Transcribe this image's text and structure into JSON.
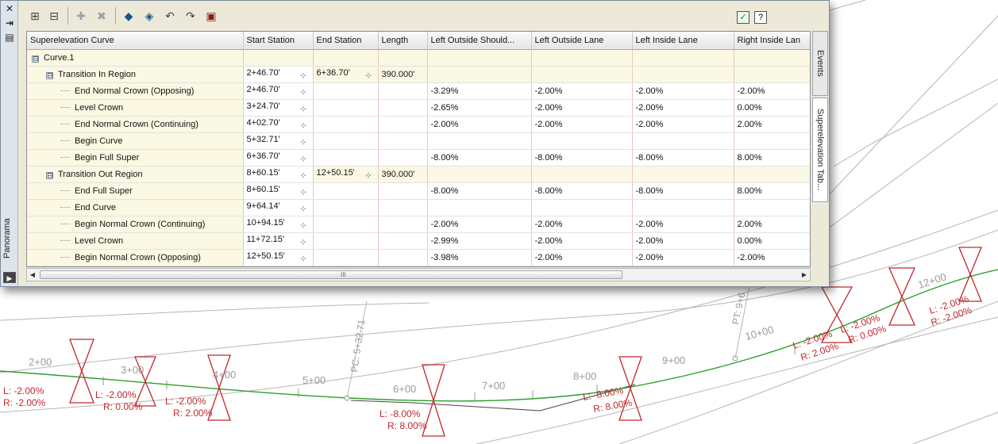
{
  "window": {
    "caption": "Panorama",
    "left_bar": {
      "close": "✕",
      "pin": "⇥",
      "props": "▤"
    },
    "toolbar_right": {
      "accept": "✓",
      "help": "?"
    }
  },
  "table": {
    "columns": [
      "Superelevation Curve",
      "Start Station",
      "End Station",
      "Length",
      "Left Outside Should...",
      "Left Outside Lane",
      "Left Inside Lane",
      "Right Inside Lan"
    ],
    "rows": [
      {
        "level": 0,
        "kind": "root",
        "expander": "⊟",
        "name": "Curve.1",
        "start": "",
        "end": "",
        "length": "",
        "los": "",
        "lol": "",
        "lil": "",
        "ril": ""
      },
      {
        "level": 1,
        "kind": "region",
        "expander": "⊟",
        "name": "Transition In Region",
        "start": "2+46.70'",
        "end": "6+36.70'",
        "length": "390.000'",
        "los": "",
        "lol": "",
        "lil": "",
        "ril": ""
      },
      {
        "level": 2,
        "kind": "item",
        "name": "End Normal Crown (Opposing)",
        "start": "2+46.70'",
        "end": "",
        "length": "",
        "los": "-3.29%",
        "lol": "-2.00%",
        "lil": "-2.00%",
        "ril": "-2.00%"
      },
      {
        "level": 2,
        "kind": "item",
        "name": "Level Crown",
        "start": "3+24.70'",
        "end": "",
        "length": "",
        "los": "-2.65%",
        "lol": "-2.00%",
        "lil": "-2.00%",
        "ril": "0.00%"
      },
      {
        "level": 2,
        "kind": "item",
        "name": "End Normal Crown (Continuing)",
        "start": "4+02.70'",
        "end": "",
        "length": "",
        "los": "-2.00%",
        "lol": "-2.00%",
        "lil": "-2.00%",
        "ril": "2.00%"
      },
      {
        "level": 2,
        "kind": "item-plain",
        "name": "Begin Curve",
        "start": "5+32.71'",
        "end": "",
        "length": "",
        "los": "",
        "lol": "",
        "lil": "",
        "ril": ""
      },
      {
        "level": 2,
        "kind": "item",
        "name": "Begin Full Super",
        "start": "6+36.70'",
        "end": "",
        "length": "",
        "los": "-8.00%",
        "lol": "-8.00%",
        "lil": "-8.00%",
        "ril": "8.00%"
      },
      {
        "level": 1,
        "kind": "region",
        "expander": "⊟",
        "name": "Transition Out Region",
        "start": "8+60.15'",
        "end": "12+50.15'",
        "length": "390.000'",
        "los": "",
        "lol": "",
        "lil": "",
        "ril": ""
      },
      {
        "level": 2,
        "kind": "item",
        "name": "End Full Super",
        "start": "8+60.15'",
        "end": "",
        "length": "",
        "los": "-8.00%",
        "lol": "-8.00%",
        "lil": "-8.00%",
        "ril": "8.00%"
      },
      {
        "level": 2,
        "kind": "item-plain",
        "name": "End Curve",
        "start": "9+64.14'",
        "end": "",
        "length": "",
        "los": "",
        "lol": "",
        "lil": "",
        "ril": ""
      },
      {
        "level": 2,
        "kind": "item",
        "name": "Begin Normal Crown (Continuing)",
        "start": "10+94.15'",
        "end": "",
        "length": "",
        "los": "-2.00%",
        "lol": "-2.00%",
        "lil": "-2.00%",
        "ril": "2.00%"
      },
      {
        "level": 2,
        "kind": "item",
        "name": "Level Crown",
        "start": "11+72.15'",
        "end": "",
        "length": "",
        "los": "-2.99%",
        "lol": "-2.00%",
        "lil": "-2.00%",
        "ril": "0.00%"
      },
      {
        "level": 2,
        "kind": "item",
        "name": "Begin Normal Crown (Opposing)",
        "start": "12+50.15'",
        "end": "",
        "length": "",
        "los": "-3.98%",
        "lol": "-2.00%",
        "lil": "-2.00%",
        "ril": "-2.00%"
      }
    ]
  },
  "scrollbar": {
    "grip": "III"
  },
  "right_tabs": {
    "events": "Events",
    "superelevation": "Superelevation Tab..."
  },
  "drawing": {
    "station_labels": [
      "2+00",
      "3+00",
      "4+00",
      "5+00",
      "6+00",
      "7+00",
      "8+00",
      "9+00",
      "10+00",
      "12+00"
    ],
    "pc_label": "PC: 5+32.71",
    "pt_label": "PT: 9+6",
    "slope_labels": [
      {
        "l": "L: -2.00%",
        "r": "R: -2.00%"
      },
      {
        "l": "L: -2.00%",
        "r": "R: 0.00%"
      },
      {
        "l": "L: -2.00%",
        "r": "R: 2.00%"
      },
      {
        "l": "L: -8.00%",
        "r": "R: 8.00%"
      },
      {
        "l": "L: -8.00%",
        "r": "R: 8.00%"
      },
      {
        "l": "L: -2.00%",
        "r": "R: 2.00%"
      },
      {
        "l": "L: -2.00%",
        "r": "R: 0.00%"
      },
      {
        "l": "L: -2.00%",
        "r": "R: -2.00%"
      }
    ],
    "colors": {
      "alignment": "#2e9e2e",
      "superelevation": "#c0282d",
      "station": "#9a9a9a",
      "background_lines": "#b5b5b5"
    }
  }
}
